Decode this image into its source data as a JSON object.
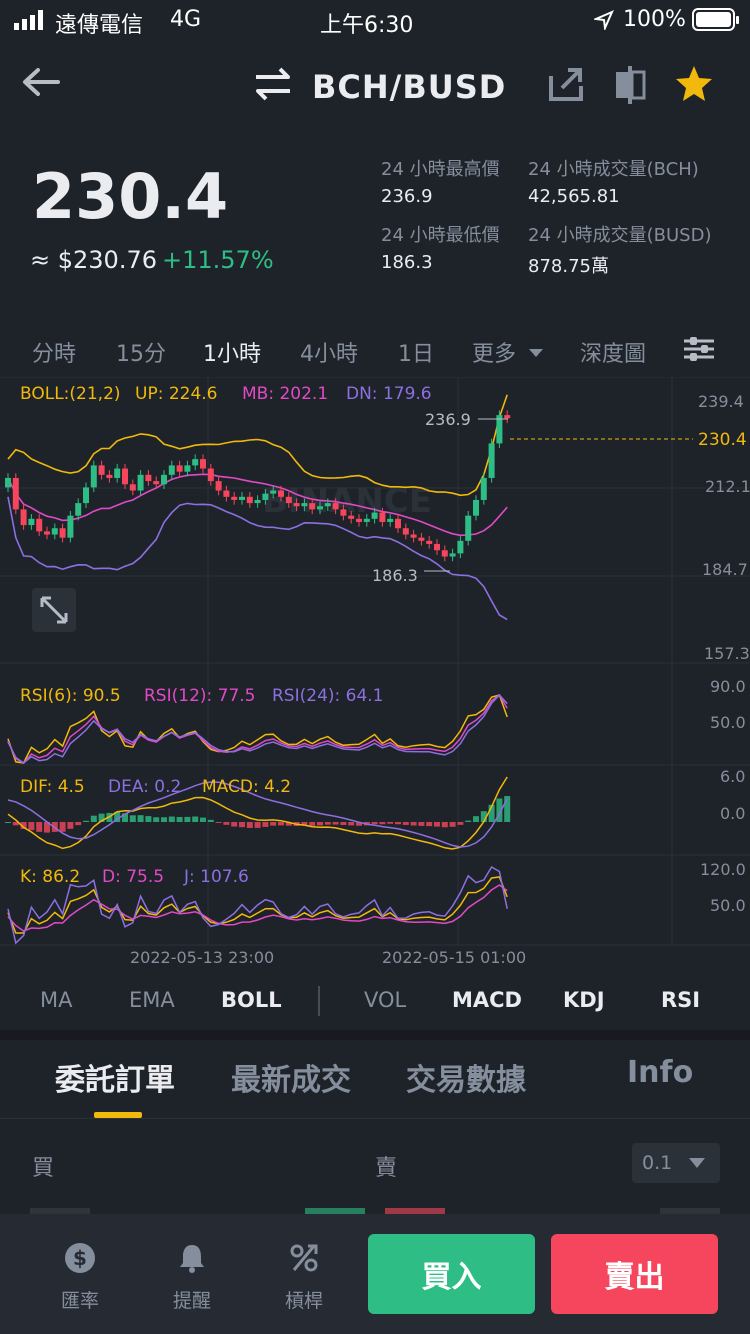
{
  "status_bar": {
    "carrier": "遠傳電信",
    "network": "4G",
    "time": "上午6:30",
    "battery": "100%"
  },
  "header": {
    "pair": "BCH/BUSD"
  },
  "ticker": {
    "last_price": "230.4",
    "usd_price": "≈ $230.76",
    "change_pct": "+11.57%",
    "high_label": "24 小時最高價",
    "high_value": "236.9",
    "low_label": "24 小時最低價",
    "low_value": "186.3",
    "vol_base_label": "24 小時成交量(BCH)",
    "vol_base_value": "42,565.81",
    "vol_quote_label": "24 小時成交量(BUSD)",
    "vol_quote_value": "878.75萬"
  },
  "timeframes": [
    "分時",
    "15分",
    "1小時",
    "4小時",
    "1日",
    "更多",
    "深度圖"
  ],
  "active_timeframe": "1小時",
  "chart_data": {
    "type": "candlestick",
    "watermark": "BINANCE",
    "boll": {
      "label": "BOLL:(21,2)",
      "up": "UP: 224.6",
      "mb": "MB: 202.1",
      "dn": "DN: 179.6"
    },
    "y_ticks": [
      "239.4",
      "212.1",
      "184.7",
      "157.3"
    ],
    "ylim": [
      157.3,
      239.4
    ],
    "last_price_tag": "230.4",
    "high_marker": "236.9",
    "low_marker": "186.3",
    "closes": [
      213,
      203,
      198,
      200,
      196,
      195,
      197,
      194,
      201,
      205,
      210,
      217,
      214,
      213,
      216,
      211,
      209,
      214,
      212,
      211,
      214,
      217,
      215,
      217,
      219,
      216,
      212,
      209,
      207,
      206,
      207,
      205,
      206,
      208,
      209,
      207,
      205,
      204,
      205,
      203,
      204,
      205,
      203,
      201,
      200,
      199,
      200,
      202,
      199,
      200,
      197,
      195,
      194,
      193,
      192,
      190,
      188,
      189,
      193,
      201,
      206,
      213,
      224,
      233,
      232
    ],
    "rsi": {
      "labels": [
        "RSI(6): 90.5",
        "RSI(12): 77.5",
        "RSI(24): 64.1"
      ],
      "y_ticks": [
        "90.0",
        "50.0"
      ]
    },
    "macd": {
      "labels": [
        "DIF: 4.5",
        "DEA: 0.2",
        "MACD: 4.2"
      ],
      "y_ticks": [
        "6.0",
        "0.0"
      ]
    },
    "kdj": {
      "labels": [
        "K: 86.2",
        "D: 75.5",
        "J: 107.6"
      ],
      "y_ticks": [
        "120.0",
        "50.0"
      ]
    },
    "x_ticks": [
      "2022-05-13 23:00",
      "2022-05-15 01:00"
    ],
    "colors": {
      "up": "#2ebd85",
      "down": "#f6465d",
      "yellow": "#f0b90b",
      "pink": "#e04ac7",
      "purple": "#8c6fe0"
    }
  },
  "indicator_tabs": [
    "MA",
    "EMA",
    "BOLL",
    "VOL",
    "MACD",
    "KDJ",
    "RSI"
  ],
  "section_tabs": [
    "委託訂單",
    "最新成交",
    "交易數據",
    "Info"
  ],
  "orderbook": {
    "buy_label": "買",
    "sell_label": "賣",
    "depth_select": "0.1"
  },
  "bottom_nav": {
    "rate": "匯率",
    "alert": "提醒",
    "leverage": "槓桿",
    "buy": "買入",
    "sell": "賣出"
  }
}
